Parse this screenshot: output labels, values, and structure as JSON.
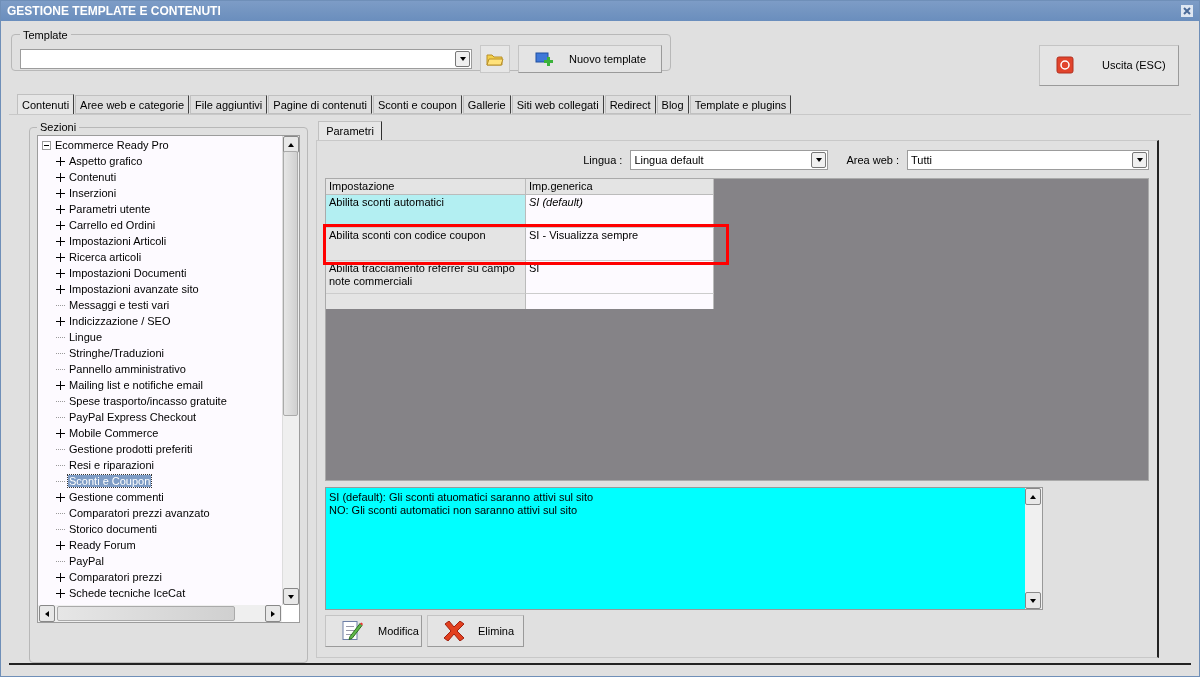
{
  "window": {
    "title": "GESTIONE TEMPLATE E CONTENUTI"
  },
  "template": {
    "label": "Template",
    "new_button": "Nuovo template"
  },
  "exit_button": "Uscita (ESC)",
  "tabs": [
    {
      "label": "Contenuti",
      "selected": true
    },
    {
      "label": "Aree web e categorie",
      "selected": false
    },
    {
      "label": "File aggiuntivi",
      "selected": false
    },
    {
      "label": "Pagine di contenuti",
      "selected": false
    },
    {
      "label": "Sconti e coupon",
      "selected": false
    },
    {
      "label": "Gallerie",
      "selected": false
    },
    {
      "label": "Siti web collegati",
      "selected": false
    },
    {
      "label": "Redirect",
      "selected": false
    },
    {
      "label": "Blog",
      "selected": false
    },
    {
      "label": "Template e plugins",
      "selected": false
    }
  ],
  "sections": {
    "label": "Sezioni",
    "tree": {
      "label": "Ecommerce Ready Pro",
      "expanded": true,
      "selected": false,
      "children": [
        {
          "label": "Aspetto grafico",
          "expandable": true,
          "selected": false
        },
        {
          "label": "Contenuti",
          "expandable": true,
          "selected": false
        },
        {
          "label": "Inserzioni",
          "expandable": true,
          "selected": false
        },
        {
          "label": "Parametri utente",
          "expandable": true,
          "selected": false
        },
        {
          "label": "Carrello ed Ordini",
          "expandable": true,
          "selected": false
        },
        {
          "label": "Impostazioni Articoli",
          "expandable": true,
          "selected": false
        },
        {
          "label": "Ricerca articoli",
          "expandable": true,
          "selected": false
        },
        {
          "label": "Impostazioni Documenti",
          "expandable": true,
          "selected": false
        },
        {
          "label": "Impostazioni avanzate sito",
          "expandable": true,
          "selected": false
        },
        {
          "label": "Messaggi e testi vari",
          "expandable": false,
          "selected": false
        },
        {
          "label": "Indicizzazione / SEO",
          "expandable": true,
          "selected": false
        },
        {
          "label": "Lingue",
          "expandable": false,
          "selected": false
        },
        {
          "label": "Stringhe/Traduzioni",
          "expandable": false,
          "selected": false
        },
        {
          "label": "Pannello amministrativo",
          "expandable": false,
          "selected": false
        },
        {
          "label": "Mailing list e notifiche email",
          "expandable": true,
          "selected": false
        },
        {
          "label": "Spese trasporto/incasso gratuite",
          "expandable": false,
          "selected": false
        },
        {
          "label": "PayPal Express Checkout",
          "expandable": false,
          "selected": false
        },
        {
          "label": "Mobile Commerce",
          "expandable": true,
          "selected": false
        },
        {
          "label": "Gestione prodotti preferiti",
          "expandable": false,
          "selected": false
        },
        {
          "label": "Resi e riparazioni",
          "expandable": false,
          "selected": false
        },
        {
          "label": "Sconti e Coupon",
          "expandable": false,
          "selected": true
        },
        {
          "label": "Gestione commenti",
          "expandable": true,
          "selected": false
        },
        {
          "label": "Comparatori prezzi avanzato",
          "expandable": false,
          "selected": false
        },
        {
          "label": "Storico documenti",
          "expandable": false,
          "selected": false
        },
        {
          "label": "Ready Forum",
          "expandable": true,
          "selected": false
        },
        {
          "label": "PayPal",
          "expandable": false,
          "selected": false
        },
        {
          "label": "Comparatori prezzi",
          "expandable": true,
          "selected": false
        },
        {
          "label": "Schede tecniche IceCat",
          "expandable": true,
          "selected": false
        }
      ]
    }
  },
  "panel_tabs": [
    {
      "label": "Parametri",
      "selected": true
    }
  ],
  "filters": [
    {
      "label": "Lingua :",
      "value": "Lingua default"
    },
    {
      "label": "Area web :",
      "value": "Tutti"
    }
  ],
  "table": {
    "columns": [
      "Impostazione",
      "Imp.generica"
    ],
    "rows": [
      {
        "setting": "Abilita sconti automatici",
        "value": "SI (default)",
        "selected": true,
        "is_default": true,
        "highlighted": false
      },
      {
        "setting": "Abilita sconti con codice coupon",
        "value": "SI - Visualizza sempre",
        "selected": false,
        "is_default": false,
        "highlighted": true
      },
      {
        "setting": "Abilita tracciamento referrer su campo note commerciali",
        "value": "SI",
        "selected": false,
        "is_default": false,
        "highlighted": false
      }
    ]
  },
  "description": [
    "SI (default): Gli sconti atuomatici saranno attivi sul sito",
    "NO: Gli sconti automatici non saranno attivi sul sito"
  ],
  "buttons": [
    {
      "kind": "edit",
      "label": "Modifica"
    },
    {
      "kind": "delete",
      "label": "Elimina"
    }
  ]
}
